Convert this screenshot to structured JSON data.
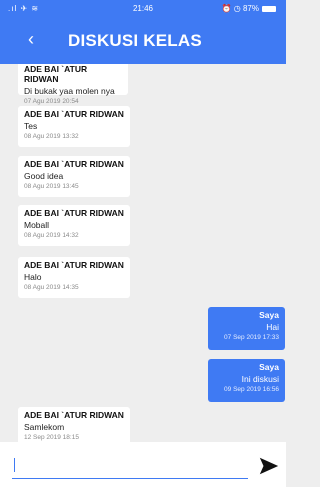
{
  "status_bar": {
    "left": ".ıl ✈ ≋",
    "time": "21:46",
    "right": "⏰ ◷ 87%"
  },
  "header": {
    "back_icon": "‹",
    "title": "DISKUSI KELAS"
  },
  "messages": [
    {
      "direction": "in",
      "sender": "ADE BAI `ATUR RIDWAN",
      "text": "Di bukak yaa molen nya",
      "time": "07 Agu 2019 20:54"
    },
    {
      "direction": "in",
      "sender": "ADE BAI `ATUR RIDWAN",
      "text": "Tes",
      "time": "08 Agu 2019 13:32"
    },
    {
      "direction": "in",
      "sender": "ADE BAI `ATUR RIDWAN",
      "text": "Good idea",
      "time": "08 Agu 2019 13:45"
    },
    {
      "direction": "in",
      "sender": "ADE BAI `ATUR RIDWAN",
      "text": "Moball",
      "time": "08 Agu 2019 14:32"
    },
    {
      "direction": "in",
      "sender": "ADE BAI `ATUR RIDWAN",
      "text": "Halo",
      "time": "08 Agu 2019 14:35"
    },
    {
      "direction": "out",
      "sender": "Saya",
      "text": "Hai",
      "time": "07 Sep 2019 17:33"
    },
    {
      "direction": "out",
      "sender": "Saya",
      "text": "Ini diskusi",
      "time": "09 Sep 2019 16:56"
    },
    {
      "direction": "in",
      "sender": "ADE BAI `ATUR RIDWAN",
      "text": "Samlekom",
      "time": "12 Sep 2019 18:15"
    }
  ],
  "composer": {
    "value": "",
    "placeholder": "",
    "send_icon": "send-icon"
  },
  "colors": {
    "primary": "#3f7af3",
    "background": "#eeeeee"
  }
}
